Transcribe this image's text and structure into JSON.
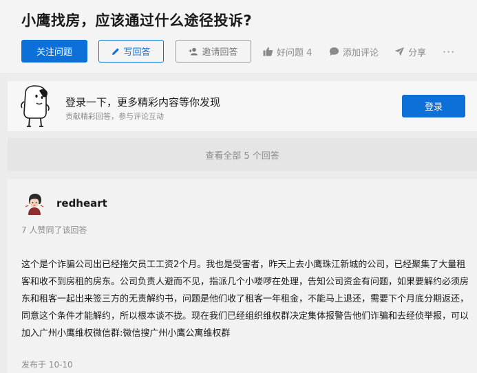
{
  "question": {
    "title": "小鹰找房，应该通过什么途径投诉?"
  },
  "actions": {
    "follow_label": "关注问题",
    "write_label": "写回答",
    "invite_label": "邀请回答",
    "good_question_label": "好问题 4",
    "comment_label": "添加评论",
    "share_label": "分享",
    "more_label": "···"
  },
  "login_prompt": {
    "main_text": "登录一下，更多精彩内容等你发现",
    "sub_text": "贡献精彩回答，参与评论互动",
    "button_label": "登录"
  },
  "view_all": {
    "label": "查看全部 5 个回答"
  },
  "answer": {
    "author": "redheart",
    "votes_text": "7 人赞同了该回答",
    "content": "这个是个诈骗公司出已经拖欠员工工资2个月。我也是受害者，昨天上去小鹰珠江新城的公司，已经聚集了大量租客和收不到房租的房东。公司负责人避而不见，指派几个小喽啰在处理，告知公司资金有问题，如果要解约必须房东和租客一起出来签三方的无责解约书，问题是他们收了租客一年租金，不能马上退还，需要下个月底分期返还，同意这个条件才能解约，所以根本谈不拢。现在我们已经组织维权群决定集体报警告他们诈骗和去经侦举报，可以加入广州小鹰维权微信群:微信搜广州小鹰公寓维权群",
    "date": "发布于 10-10"
  },
  "colors": {
    "primary": "#0d6fd8",
    "muted_text": "#8a8a8a",
    "background": "#ececec"
  },
  "icons": [
    "pencil-icon",
    "invite-user-icon",
    "thumbs-up-icon",
    "comment-icon",
    "share-icon",
    "more-icon",
    "mascot-icon",
    "avatar"
  ]
}
